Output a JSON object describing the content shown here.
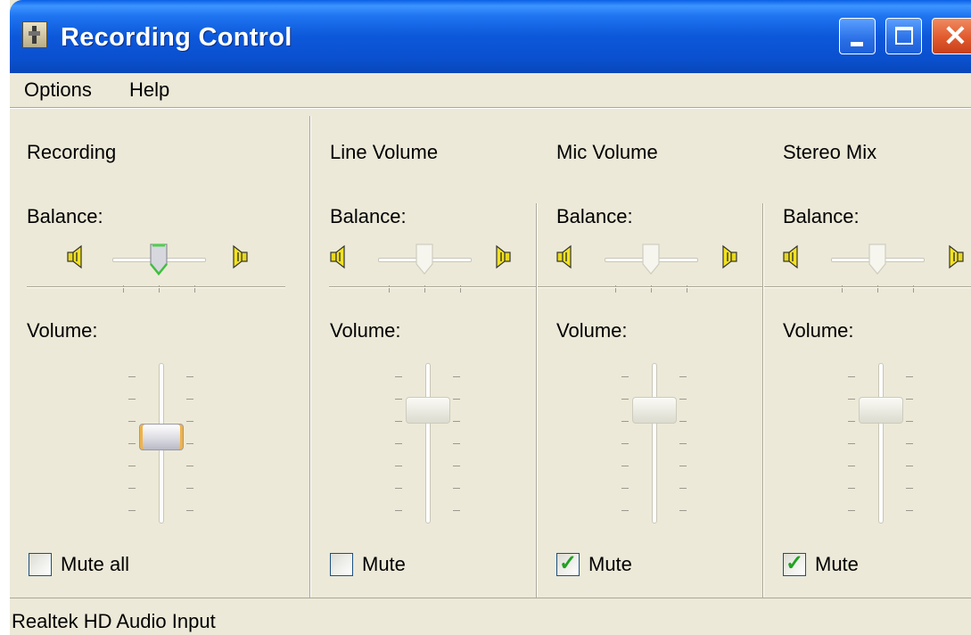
{
  "window": {
    "title": "Recording Control",
    "minimize_icon": "minimize-icon",
    "maximize_icon": "maximize-icon",
    "close_icon": "close-icon"
  },
  "menu": {
    "options": "Options",
    "help": "Help"
  },
  "channels": [
    {
      "title": "Recording",
      "balance_label": "Balance:",
      "volume_label": "Volume:",
      "mute_label": "Mute all",
      "muted": false
    },
    {
      "title": "Line Volume",
      "balance_label": "Balance:",
      "volume_label": "Volume:",
      "mute_label": "Mute",
      "muted": false
    },
    {
      "title": "Mic Volume",
      "balance_label": "Balance:",
      "volume_label": "Volume:",
      "mute_label": "Mute",
      "muted": true
    },
    {
      "title": "Stereo Mix",
      "balance_label": "Balance:",
      "volume_label": "Volume:",
      "mute_label": "Mute",
      "muted": true
    }
  ],
  "status": {
    "device": "Realtek HD Audio Input"
  },
  "colors": {
    "titlebar": "#0A50CF",
    "dialog_bg": "#ECE9D8",
    "checkmark": "#21A121",
    "close_button": "#E05A2E"
  }
}
